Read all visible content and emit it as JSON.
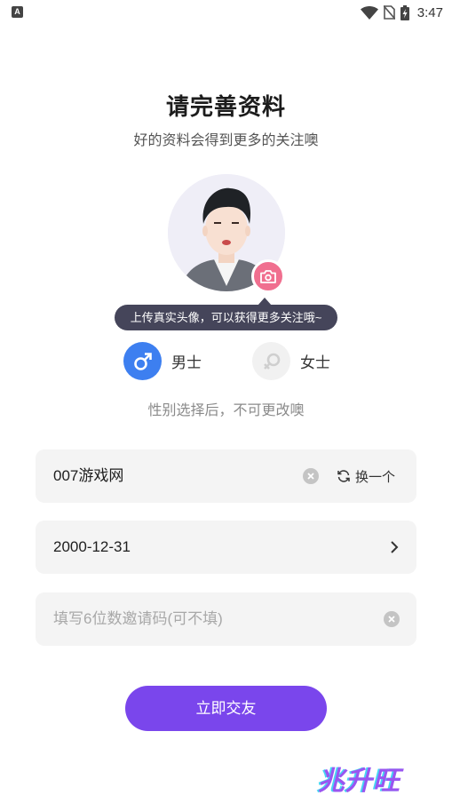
{
  "status_bar": {
    "notification_badge": "A",
    "icons": [
      "wifi-icon",
      "no-sim-icon",
      "battery-charging-icon"
    ],
    "time": "3:47"
  },
  "header": {
    "title": "请完善资料",
    "subtitle": "好的资料会得到更多的关注噢"
  },
  "avatar": {
    "icon": "default-male-avatar",
    "upload_icon": "camera-icon",
    "tooltip": "上传真实头像，可以获得更多关注哦~"
  },
  "gender": {
    "options": [
      {
        "label": "男士",
        "icon": "male-icon",
        "selected": true,
        "color": "#3d7ff0"
      },
      {
        "label": "女士",
        "icon": "female-icon",
        "selected": false,
        "color": "#f1f1f1"
      }
    ],
    "note": "性别选择后，不可更改噢"
  },
  "form": {
    "nickname": {
      "value": "007游戏网",
      "swap_label": "换一个"
    },
    "birthday": {
      "value": "2000-12-31"
    },
    "invite_code": {
      "value": "",
      "placeholder": "填写6位数邀请码(可不填)"
    }
  },
  "submit": {
    "label": "立即交友",
    "color": "#7a46ec"
  },
  "watermark": {
    "text": "兆升旺"
  }
}
